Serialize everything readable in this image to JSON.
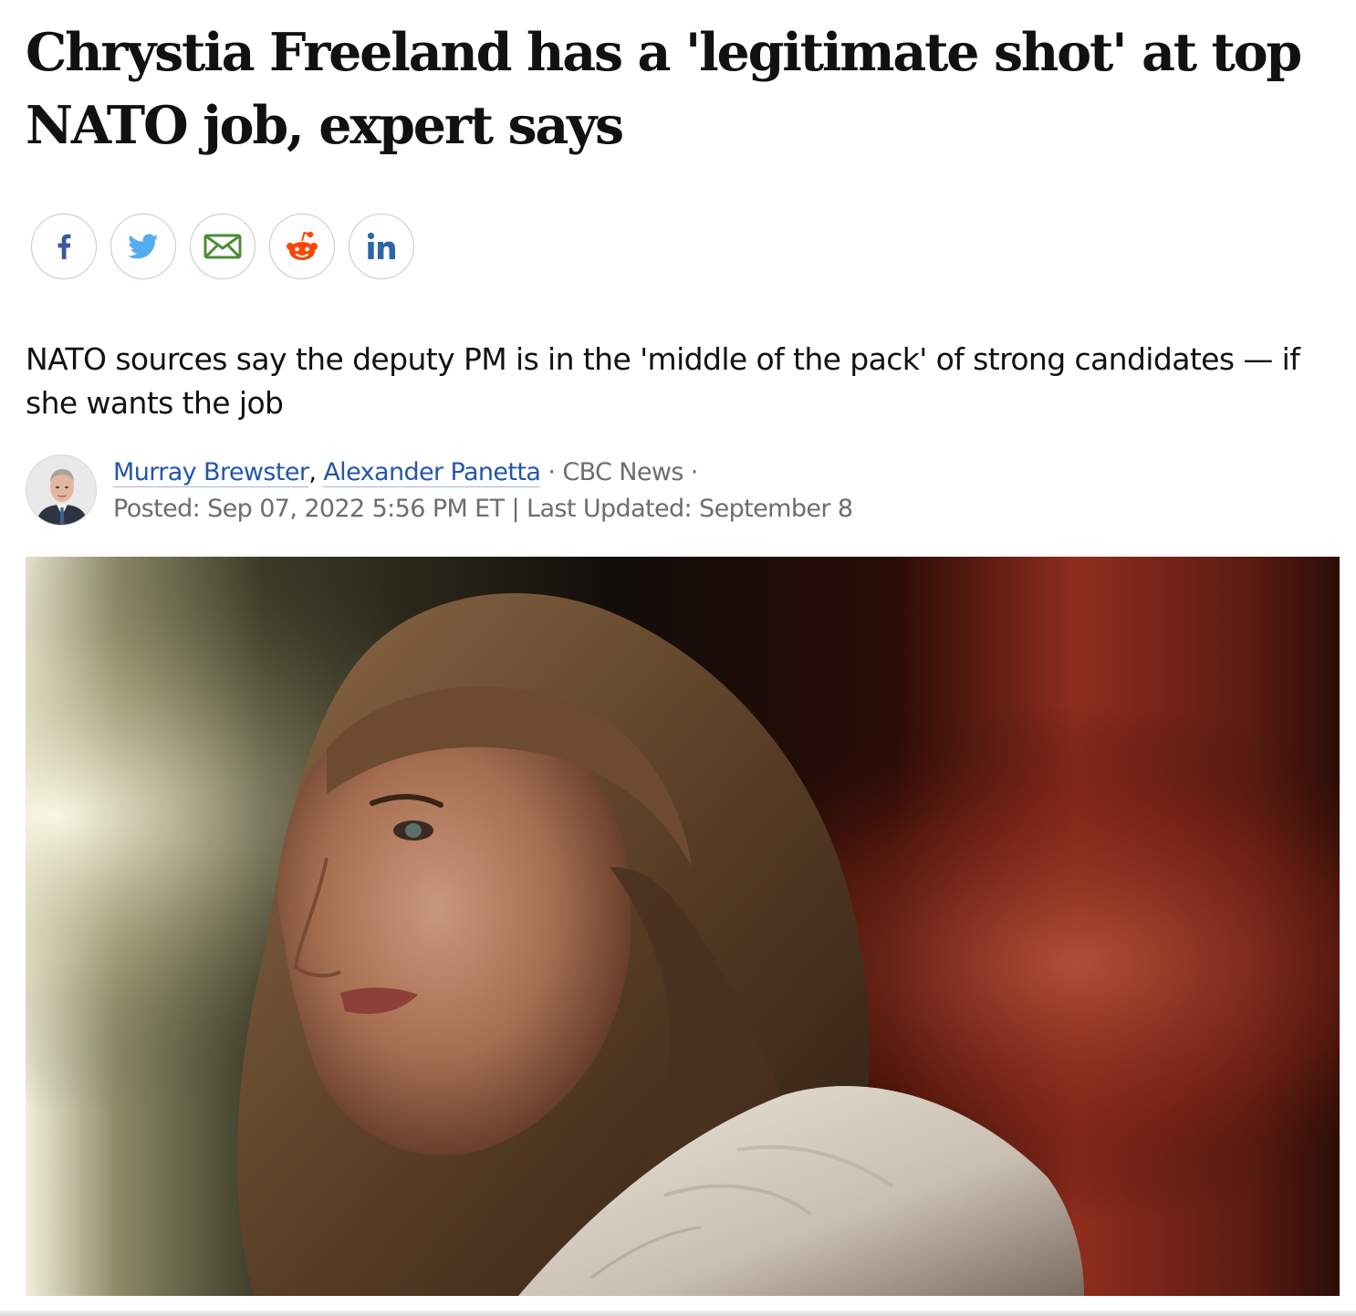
{
  "article": {
    "headline": "Chrystia Freeland has a 'legitimate shot' at top NATO job, expert says",
    "deck": "NATO sources say the deputy PM is in the 'middle of the pack' of strong candidates — if she wants the job"
  },
  "share": {
    "buttons": [
      {
        "icon": "facebook-icon",
        "color": "#3b5998"
      },
      {
        "icon": "twitter-icon",
        "color": "#55acee"
      },
      {
        "icon": "email-icon",
        "color": "#4c8c3a"
      },
      {
        "icon": "reddit-icon",
        "color": "#ff4500"
      },
      {
        "icon": "linkedin-icon",
        "color": "#2a66a8"
      }
    ]
  },
  "byline": {
    "authors": [
      "Murray Brewster",
      "Alexander Panetta"
    ],
    "separator": ", ",
    "source": "CBC News",
    "dot": "·",
    "posted_label": "Posted: Sep 07, 2022 5:56 PM ET",
    "divider": "|",
    "updated_label": "Last Updated: September 8"
  },
  "colors": {
    "link": "#2456a8",
    "meta": "#6d6d6d",
    "text": "#111111"
  }
}
